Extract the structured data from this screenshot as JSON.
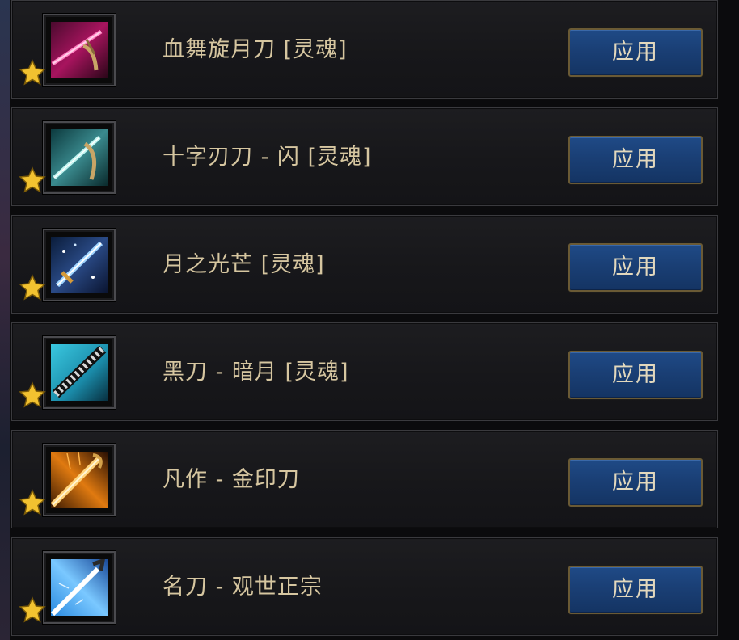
{
  "items": [
    {
      "name": "血舞旋月刀 [灵魂]",
      "button_label": "应用",
      "icon": "pink-sword-icon",
      "star_icon": "gold-star-icon"
    },
    {
      "name": "十字刃刀 - 闪 [灵魂]",
      "button_label": "应用",
      "icon": "teal-sword-icon",
      "star_icon": "gold-star-icon"
    },
    {
      "name": "月之光芒 [灵魂]",
      "button_label": "应用",
      "icon": "blue-sword-icon",
      "star_icon": "gold-star-icon"
    },
    {
      "name": "黑刀 - 暗月 [灵魂]",
      "button_label": "应用",
      "icon": "black-sword-icon",
      "star_icon": "gold-star-icon"
    },
    {
      "name": "凡作 - 金印刀",
      "button_label": "应用",
      "icon": "golden-sword-icon",
      "star_icon": "gold-star-icon"
    },
    {
      "name": "名刀 - 观世正宗",
      "button_label": "应用",
      "icon": "lightblue-sword-icon",
      "star_icon": "gold-star-icon"
    }
  ],
  "colors": {
    "name_text": "#d6c6a0",
    "button_bg": "#1a3f75",
    "button_border": "#6a5a35",
    "row_bg": "#17171a",
    "star": "#f2c230"
  }
}
